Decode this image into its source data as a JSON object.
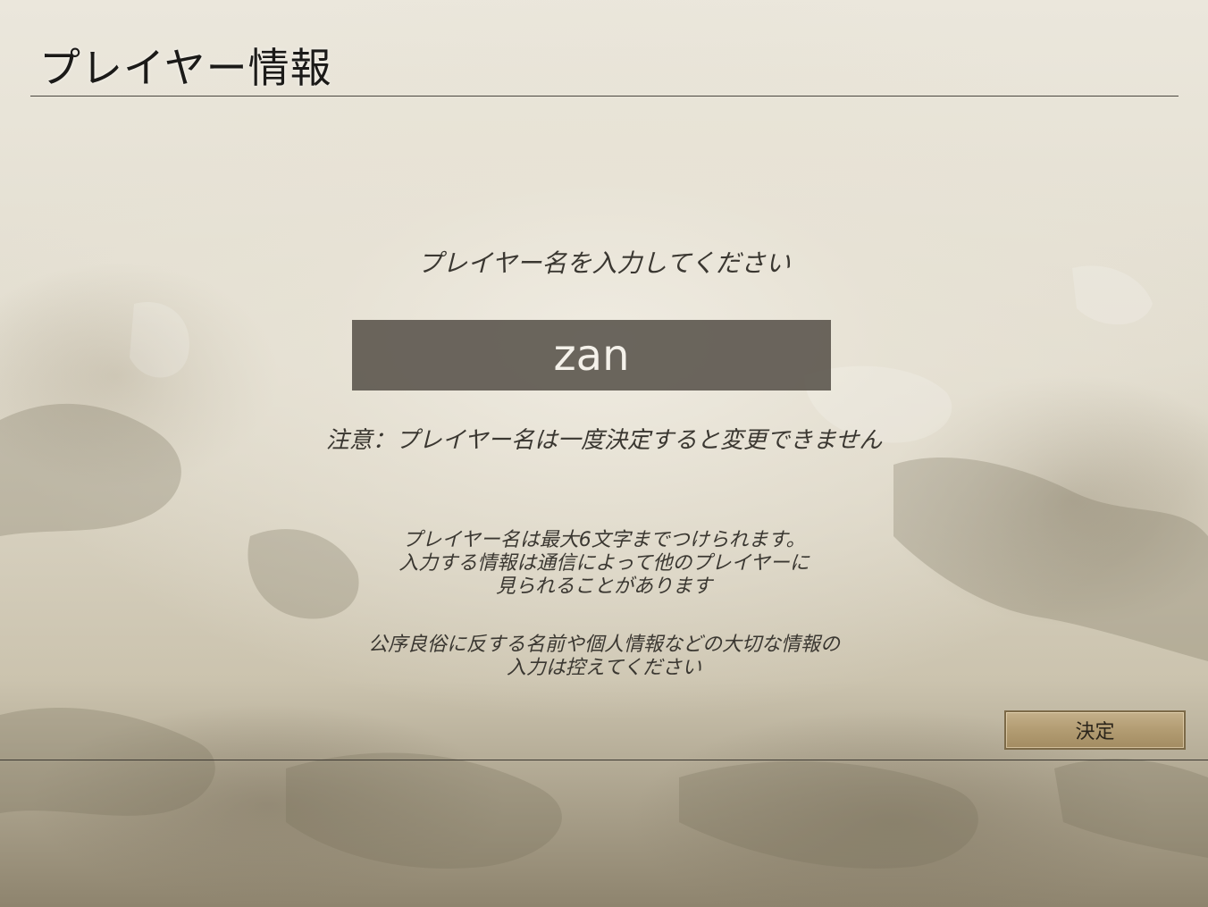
{
  "header": {
    "title": "プレイヤー情報"
  },
  "form": {
    "prompt": "プレイヤー名を入力してください",
    "player_name_value": "zan",
    "warning": "注意：プレイヤー名は一度決定すると変更できません"
  },
  "notes": {
    "rules_lines": [
      "プレイヤー名は最大6文字までつけられます。",
      "入力する情報は通信によって他のプレイヤーに",
      "見られることがあります"
    ],
    "caution_lines": [
      "公序良俗に反する名前や個人情報などの大切な情報の",
      "入力は控えてください"
    ]
  },
  "actions": {
    "confirm_label": "決定"
  },
  "colors": {
    "input_bg": "#58524a",
    "button_gold": "#b29c72",
    "text_dark": "#3a3731"
  }
}
